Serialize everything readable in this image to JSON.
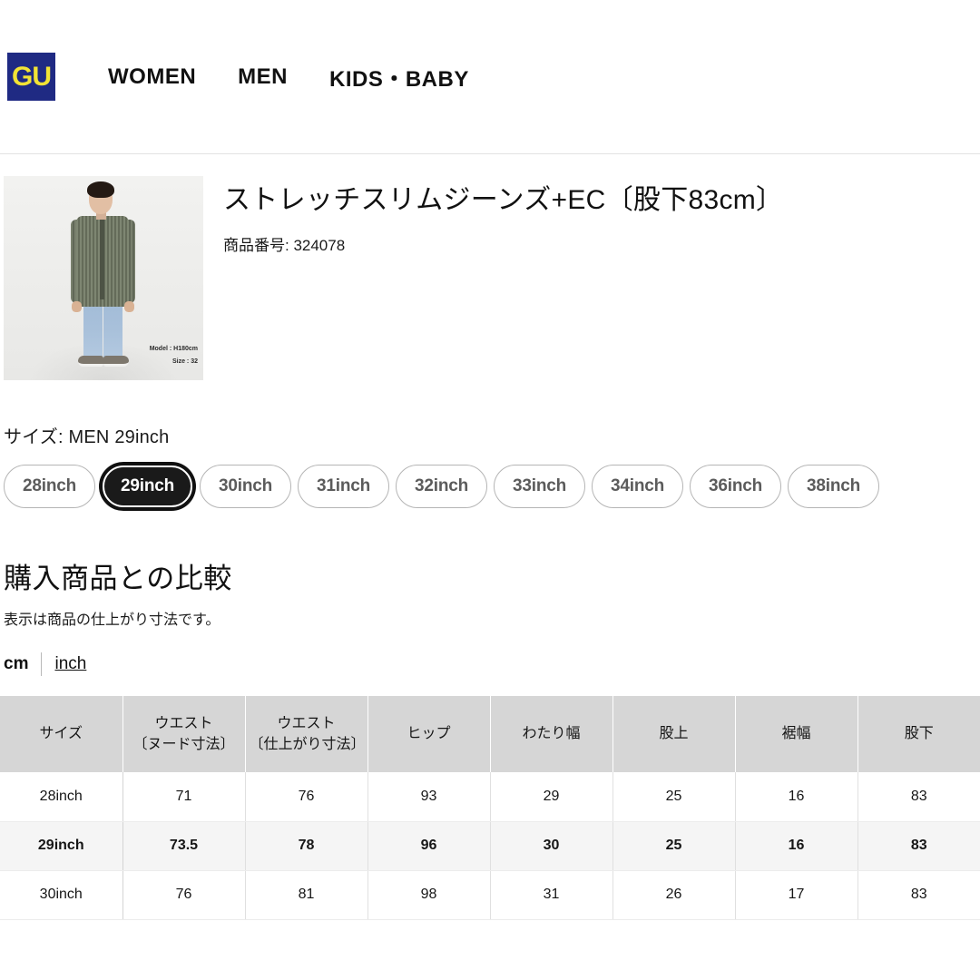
{
  "header": {
    "logo_text": "GU",
    "logo_bg": "#1f2a83",
    "logo_fg": "#f2e335",
    "nav": [
      {
        "label": "WOMEN"
      },
      {
        "label": "MEN"
      },
      {
        "label": "KIDS・BABY"
      }
    ]
  },
  "product": {
    "title": "ストレッチスリムジーンズ+EC〔股下83cm〕",
    "code_label": "商品番号: 324078",
    "image_caption_model": "Model : H180cm",
    "image_caption_size": "Size : 32"
  },
  "size_selector": {
    "label": "サイズ: MEN 29inch",
    "chips": [
      {
        "label": "28inch",
        "selected": false
      },
      {
        "label": "29inch",
        "selected": true
      },
      {
        "label": "30inch",
        "selected": false
      },
      {
        "label": "31inch",
        "selected": false
      },
      {
        "label": "32inch",
        "selected": false
      },
      {
        "label": "33inch",
        "selected": false
      },
      {
        "label": "34inch",
        "selected": false
      },
      {
        "label": "36inch",
        "selected": false
      },
      {
        "label": "38inch",
        "selected": false
      }
    ]
  },
  "compare": {
    "heading": "購入商品との比較",
    "note": "表示は商品の仕上がり寸法です。",
    "unit_cm": "cm",
    "unit_inch": "inch",
    "active_unit": "cm"
  },
  "chart_data": {
    "type": "table",
    "title": "購入商品との比較",
    "columns": [
      "サイズ",
      "ウエスト\n〔ヌード寸法〕",
      "ウエスト\n〔仕上がり寸法〕",
      "ヒップ",
      "わたり幅",
      "股上",
      "裾幅",
      "股下"
    ],
    "column_parts": [
      {
        "line1": "サイズ",
        "line2": ""
      },
      {
        "line1": "ウエスト",
        "line2": "〔ヌード寸法〕"
      },
      {
        "line1": "ウエスト",
        "line2": "〔仕上がり寸法〕"
      },
      {
        "line1": "ヒップ",
        "line2": ""
      },
      {
        "line1": "わたり幅",
        "line2": ""
      },
      {
        "line1": "股上",
        "line2": ""
      },
      {
        "line1": "裾幅",
        "line2": ""
      },
      {
        "line1": "股下",
        "line2": ""
      }
    ],
    "unit": "cm",
    "rows": [
      {
        "size": "28inch",
        "values": [
          "71",
          "76",
          "93",
          "29",
          "25",
          "16",
          "83"
        ],
        "highlight": false
      },
      {
        "size": "29inch",
        "values": [
          "73.5",
          "78",
          "96",
          "30",
          "25",
          "16",
          "83"
        ],
        "highlight": true
      },
      {
        "size": "30inch",
        "values": [
          "76",
          "81",
          "98",
          "31",
          "26",
          "17",
          "83"
        ],
        "highlight": false
      }
    ]
  }
}
